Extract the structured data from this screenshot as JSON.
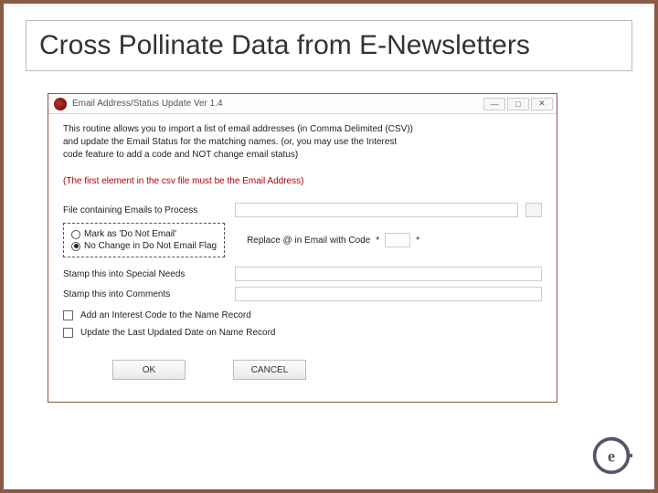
{
  "slide": {
    "title": "Cross Pollinate Data from E-Newsletters"
  },
  "dialog": {
    "title": "Email Address/Status Update Ver 1.4",
    "intro_line1": "This routine allows you to import a list of email addresses (in Comma Delimited (CSV))",
    "intro_line2": "and update the Email Status for the matching names. (or, you may use the Interest",
    "intro_line3": "code feature to add a code and NOT change email status)",
    "warning": "(The first element in the csv file must be the Email Address)",
    "file_label": "File containing Emails to Process",
    "radio1": "Mark as 'Do Not Email'",
    "radio2": "No Change in Do Not Email Flag",
    "replace_label": "Replace @ in Email with Code",
    "stamp_special": "Stamp this into Special Needs",
    "stamp_comments": "Stamp this into Comments",
    "interest_chk": "Add an Interest Code to the Name Record",
    "update_chk": "Update the Last Updated Date on Name Record",
    "ok": "OK",
    "cancel": "CANCEL",
    "star": "*"
  }
}
